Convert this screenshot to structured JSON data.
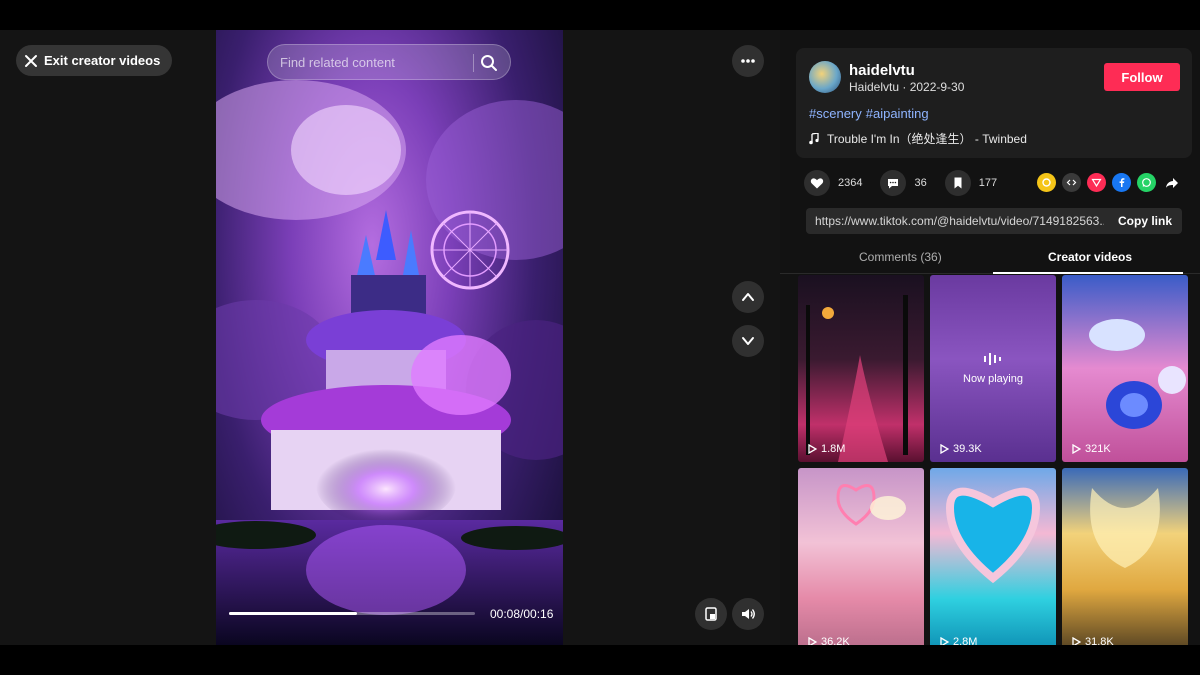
{
  "exit_label": "Exit creator videos",
  "search": {
    "placeholder": "Find related content"
  },
  "player": {
    "time": "00:08/00:16",
    "progress": 0.52
  },
  "author": {
    "username": "haidelvtu",
    "meta": "Haidelvtu · 2022-9-30",
    "follow_label": "Follow",
    "tags": [
      "#scenery",
      "#aipainting"
    ],
    "music": "Trouble I'm In（绝处逢生） - Twinbed"
  },
  "stats": {
    "likes": "2364",
    "comments": "36",
    "saves": "177"
  },
  "share_icons": [
    {
      "name": "coin-share-icon",
      "color": "#f5c518"
    },
    {
      "name": "embed-icon",
      "color": "#3a3a3a"
    },
    {
      "name": "send-icon",
      "color": "#fe2c55"
    },
    {
      "name": "facebook-icon",
      "color": "#1877f2"
    },
    {
      "name": "whatsapp-icon",
      "color": "#25d366"
    },
    {
      "name": "share-arrow-icon",
      "color": "transparent"
    }
  ],
  "link": {
    "url": "https://www.tiktok.com/@haidelvtu/video/7149182563...",
    "copy_label": "Copy link"
  },
  "tabs": {
    "comments": "Comments (36)",
    "creator": "Creator videos"
  },
  "now_playing": "Now playing",
  "videos": [
    {
      "views": "1.8M"
    },
    {
      "views": "39.3K"
    },
    {
      "views": "321K"
    },
    {
      "views": "36.2K"
    },
    {
      "views": "2.8M"
    },
    {
      "views": "31.8K"
    }
  ]
}
